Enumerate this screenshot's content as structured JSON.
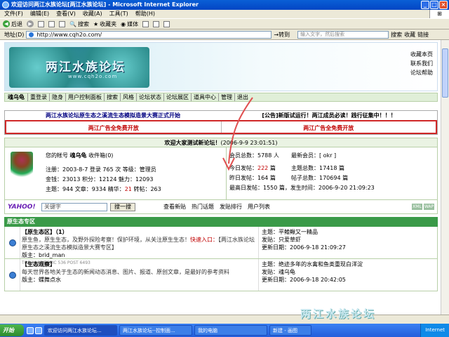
{
  "window": {
    "title": "欢迎访问两江水族论坛[两江水族论坛] - Microsoft Internet Explorer",
    "menu": [
      "文件(F)",
      "编辑(E)",
      "查看(V)",
      "收藏(A)",
      "工具(T)",
      "帮助(H)"
    ]
  },
  "toolbar": {
    "back": "后退",
    "search": "搜索",
    "favorites": "收藏夹",
    "media": "媒体"
  },
  "address": {
    "label": "地址(D)",
    "url": "http://www.cqh2o.com/",
    "search_placeholder": "输入文字，然后搜索",
    "search_btn": "搜索",
    "fav_btn": "收藏",
    "go": "转到",
    "links": "链接"
  },
  "site": {
    "logo_text": "两江水族论坛",
    "logo_url": "www.cqh2o.com",
    "top_links": [
      "收藏本页",
      "联系我们",
      "论坛帮助"
    ],
    "user": "魂乌龟",
    "nav": [
      "重登录",
      "隐身",
      "用户控制面板",
      "搜索",
      "风格",
      "论坛状态",
      "论坛展区",
      "道具中心",
      "管理",
      "退出"
    ]
  },
  "announce": {
    "left": "两江水族论坛原生态之溪流生态模拟造景大赛正式开始",
    "right": "[公告]新版试运行！两江成员必读！践行征集中！！！",
    "ad_left": "两江广告全免费开放",
    "ad_right": "两江广告全免费开放"
  },
  "welcome": {
    "text": "欢迎大家测试新论坛！",
    "date": "(2006-9-9 23:01:51)"
  },
  "userinfo": {
    "account": "您的帐号",
    "name": "魂乌龟",
    "inbox": "收件箱(0)",
    "reg": "注册：2003-8-7  登录 765 次  等级：管理员",
    "money_line": "金钱：23013  积分：12124  魅力：12093",
    "topic_line_a": "主题：944  文章：9334  精华：",
    "elite": "21",
    "topic_line_b": "  转帖：263"
  },
  "forumstats": {
    "members_label": "会员总数：",
    "members": "5788 人",
    "newest_label": "最新会员：[",
    "newest": " okr ",
    "newest_end": "]",
    "today_label": "今日发帖：",
    "today": "222",
    "today_unit": " 篇",
    "topics_label": "主题总数：",
    "topics": "17418",
    "topics_unit": " 篇",
    "yday_label": "昨日发帖：",
    "yday": "164",
    "yday_unit": " 篇",
    "posts_label": "帖子总数：",
    "posts": "170694",
    "posts_unit": " 篇",
    "peak": "最高日发帖：1550 篇，发生时间：2006-9-20 21:09:23"
  },
  "searchline": {
    "yahoo": "YAHOO!",
    "keyword": "关键字",
    "btn": "搜一搜",
    "quick": [
      "查看新贴",
      "热门话题",
      "发贴排行",
      "用户列表"
    ],
    "xbtns": [
      "XML",
      "WAP"
    ]
  },
  "section": {
    "title": "原生态专区"
  },
  "forums": [
    {
      "title": "【原生态区】（1）",
      "desc": "原生鱼，原生生态，及野外探险考察！保护环境，从关注原生生态！",
      "quick_label": "快速入口：",
      "quick": "【两江水族论坛原生态之溪流生态模拟造景大赛专区】",
      "mods": "版主：brid_man",
      "counts": "TODAY 13  TOPIC 536  POST 6493",
      "last_topic": "主题：平鳍鳅又一精品",
      "last_user": "发贴：只爱草虾",
      "last_time": "更新日期：2006-9-18 21:09:27"
    },
    {
      "title": "【生态观察】",
      "desc": "每天世界各地关于生态的新闻动态消息、图片、报道、原创文章，是最好的参考资料",
      "quick_label": "",
      "quick": "",
      "mods": "版主：蝶舞点水",
      "counts": "",
      "last_topic": "主题：绝迹多年的水禽和鱼类重现白洋淀",
      "last_user": "发贴：魂乌龟",
      "last_time": "更新日期：2006-9-18 20:42:05"
    }
  ],
  "statusbar": {
    "text": ""
  },
  "taskbar": {
    "start": "开始",
    "tasks": [
      "欢迎访问两江水族论坛...",
      "两江水族论坛--控制面...",
      "我的电脑",
      "新建 - 画图"
    ],
    "tray": "Internet"
  },
  "watermark": "两江水族论坛"
}
